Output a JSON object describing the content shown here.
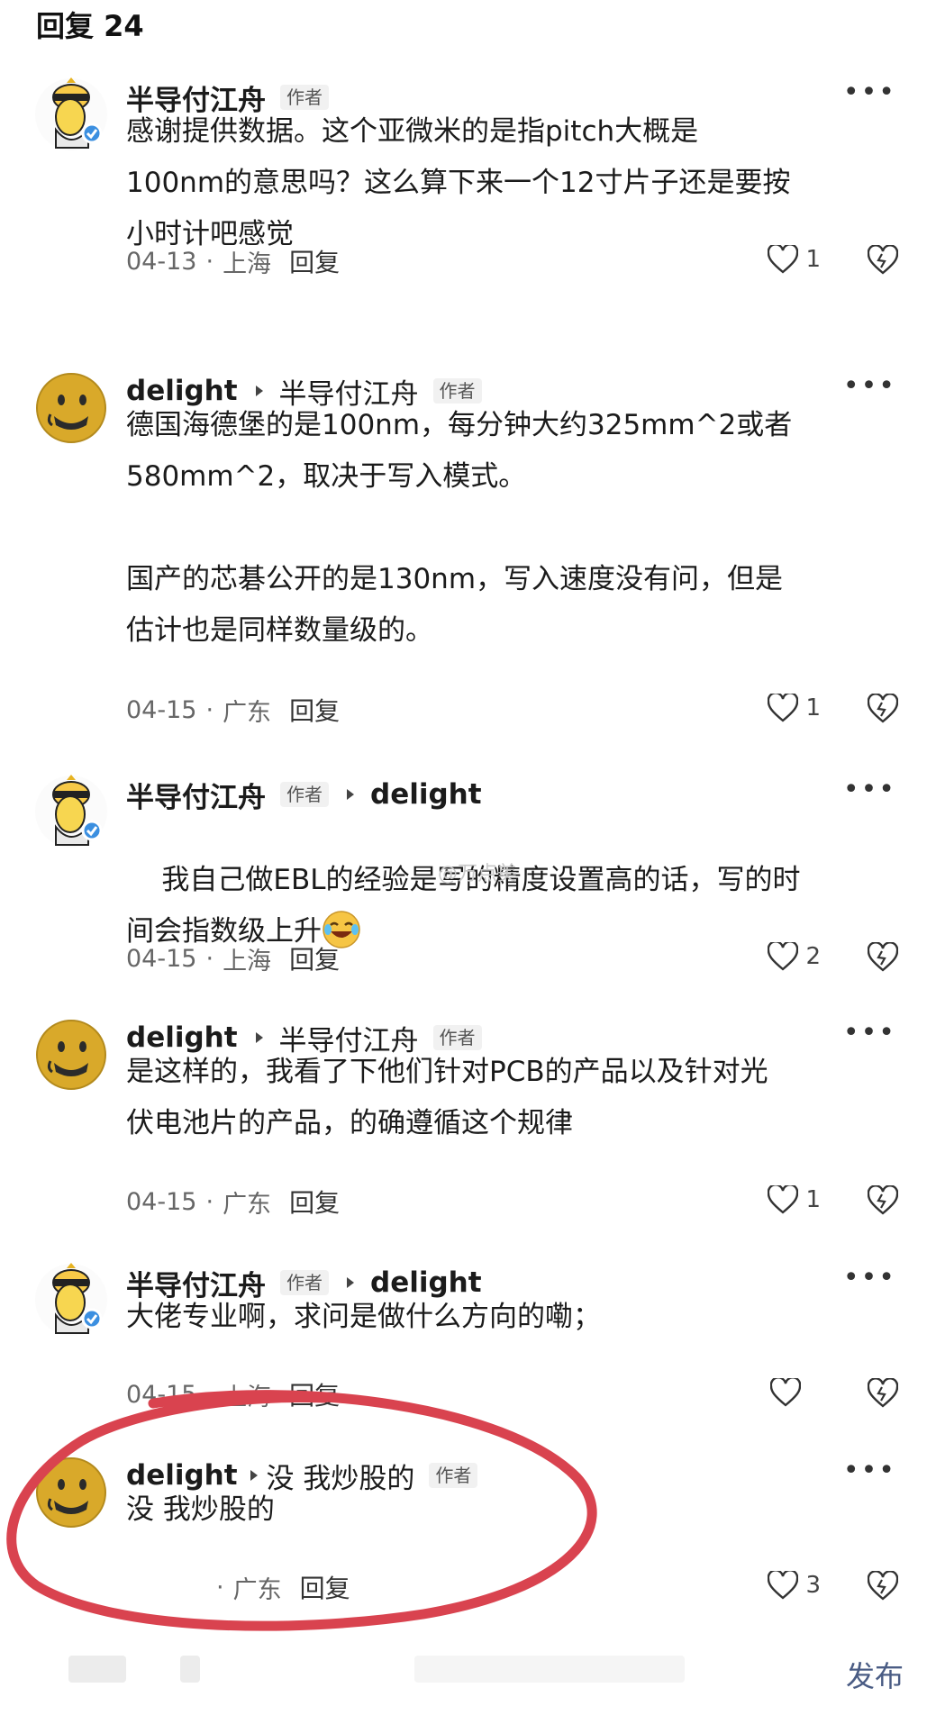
{
  "header": {
    "title": "回复 24"
  },
  "replies": [
    {
      "user": "半导付江舟",
      "author_tag": "作者",
      "reply_to": "",
      "text": "感谢提供数据。这个亚微米的是指pitch大概是\n100nm的意思吗？这么算下来一个12寸片子还是要按\n小时计吧感觉",
      "date": "04-13",
      "location": "上海",
      "reply_label": "回复",
      "likes": "1",
      "avatar_icon": "duck-avatar-icon"
    },
    {
      "user": "delight",
      "author_tag": "作者",
      "reply_to": "半导付江舟",
      "text": "德国海德堡的是100nm，每分钟大约325mm^2或者\n580mm^2，取决于写入模式。\n\n国产的芯碁公开的是130nm，写入速度没有问，但是\n估计也是同样数量级的。",
      "date": "04-15",
      "location": "广东",
      "reply_label": "回复",
      "likes": "1",
      "avatar_icon": "emoji-face-avatar-icon"
    },
    {
      "user": "半导付江舟",
      "author_tag": "作者",
      "reply_to": "delight",
      "text": "我自己做EBL的经验是写的精度设置高的话，写的时\n间会指数级上升",
      "date": "04-15",
      "location": "上海",
      "reply_label": "回复",
      "likes": "2",
      "avatar_icon": "duck-avatar-icon"
    },
    {
      "user": "delight",
      "author_tag": "作者",
      "reply_to": "半导付江舟",
      "text": "是这样的，我看了下他们针对PCB的产品以及针对光\n伏电池片的产品，的确遵循这个规律",
      "date": "04-15",
      "location": "广东",
      "reply_label": "回复",
      "likes": "1",
      "avatar_icon": "emoji-face-avatar-icon"
    },
    {
      "user": "半导付江舟",
      "author_tag": "作者",
      "reply_to": "delight",
      "text": "大佬专业啊，求问是做什么方向的嘞；",
      "date": "04-15",
      "location": "上海",
      "reply_label": "回复",
      "likes": "",
      "avatar_icon": "duck-avatar-icon"
    },
    {
      "user": "delight",
      "author_tag": "作者",
      "reply_to": "没 我炒股的",
      "text": "没 我炒股的",
      "date": "",
      "location": "广东",
      "reply_label": "回复",
      "likes": "3",
      "avatar_icon": "emoji-face-avatar-icon"
    }
  ],
  "watermark": "@万点美",
  "bottom": {
    "publish_label": "发布"
  },
  "colors": {
    "highlight_circle": "#d9434f",
    "publish": "#4a5c84",
    "verified": "#3b8fe0"
  }
}
